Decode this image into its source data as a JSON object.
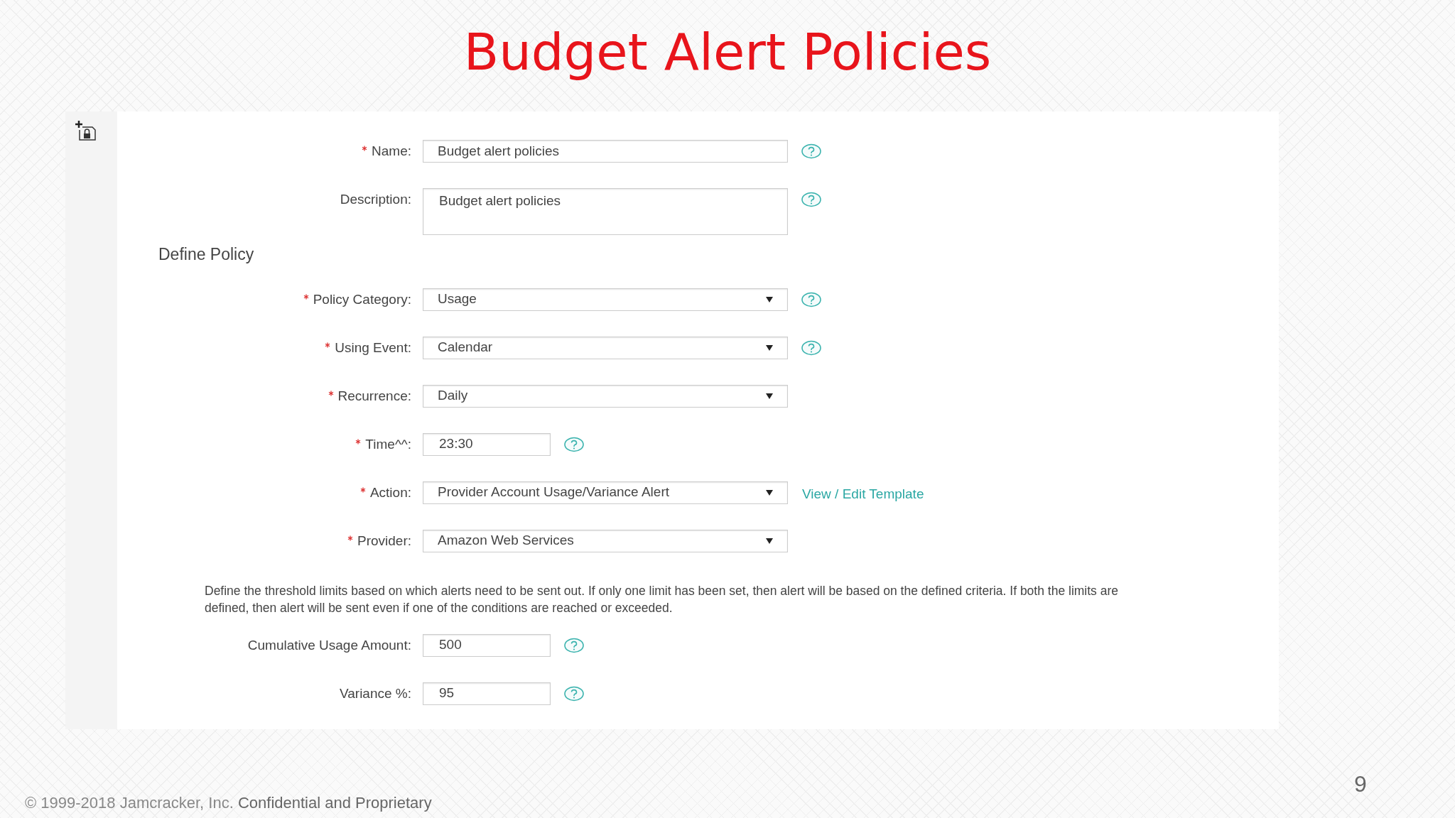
{
  "title": "Budget Alert Policies",
  "form": {
    "items": [
      {
        "kind": "text",
        "label": "Name:",
        "required": true,
        "value": "Budget alert policies",
        "help": true
      },
      {
        "kind": "textarea",
        "label": "Description:",
        "required": false,
        "value": "Budget alert policies",
        "help": true
      },
      {
        "kind": "heading",
        "text": "Define Policy"
      },
      {
        "kind": "select",
        "label": "Policy Category:",
        "required": true,
        "value": "Usage",
        "help": true
      },
      {
        "kind": "select",
        "label": "Using Event:",
        "required": true,
        "value": "Calendar",
        "help": true
      },
      {
        "kind": "select",
        "label": "Recurrence:",
        "required": true,
        "value": "Daily",
        "help": false
      },
      {
        "kind": "short",
        "label": "Time^^:",
        "required": true,
        "value": "23:30",
        "help": true
      },
      {
        "kind": "select",
        "label": "Action:",
        "required": true,
        "value": "Provider Account Usage/Variance Alert",
        "help": false,
        "link": "View / Edit Template"
      },
      {
        "kind": "select",
        "label": "Provider:",
        "required": true,
        "value": "Amazon Web Services",
        "help": false
      },
      {
        "kind": "note",
        "text": "Define the threshold limits based on which alerts need to be sent out.  If only one limit has been set, then alert will be based on the defined criteria. If both the limits are defined, then alert will be sent even if one of the conditions are reached or exceeded."
      },
      {
        "kind": "short",
        "label": "Cumulative Usage Amount:",
        "required": false,
        "value": "500",
        "help": true
      },
      {
        "kind": "short",
        "label": "Variance %:",
        "required": false,
        "value": "95",
        "help": true
      }
    ]
  },
  "footer": {
    "copyright": "© 1999-2018 Jamcracker, Inc.",
    "confidential": "Confidential and Proprietary",
    "page": "9"
  }
}
